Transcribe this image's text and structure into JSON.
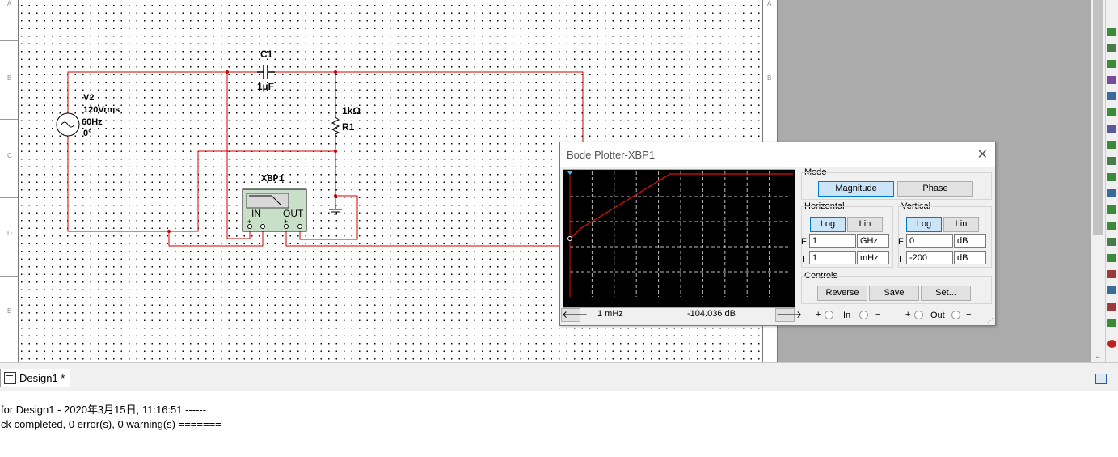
{
  "circuit": {
    "capacitor": {
      "name": "C1",
      "value": "1µF"
    },
    "resistor": {
      "name": "R1",
      "value": "1kΩ"
    },
    "source": {
      "name": "V2",
      "voltage": "120Vrms",
      "freq": "60Hz",
      "phase": "0°"
    },
    "instrument": {
      "name": "XBP1",
      "in_label": "IN",
      "out_label": "OUT"
    },
    "wire_color": "#d00000",
    "row_labels": [
      "A",
      "B",
      "C",
      "D",
      "E"
    ]
  },
  "bode": {
    "title": "Bode Plotter-XBP1",
    "mode_label": "Mode",
    "magnitude_label": "Magnitude",
    "phase_label": "Phase",
    "horizontal_label": "Horizontal",
    "vertical_label": "Vertical",
    "log_label": "Log",
    "lin_label": "Lin",
    "h_f_label": "F",
    "h_i_label": "I",
    "v_f_label": "F",
    "v_i_label": "I",
    "h_final": "1",
    "h_final_unit": "GHz",
    "h_initial": "1",
    "h_initial_unit": "mHz",
    "v_final": "0",
    "v_final_unit": "dB",
    "v_initial": "-200",
    "v_initial_unit": "dB",
    "controls_label": "Controls",
    "reverse_label": "Reverse",
    "save_label": "Save",
    "set_label": "Set...",
    "readout_freq": "1 mHz",
    "readout_value": "-104.036 dB",
    "in_label": "In",
    "out_label": "Out",
    "plus": "+",
    "minus": "−",
    "left_arrow": "🡐",
    "right_arrow": "🡒",
    "close": "✕",
    "trace_color": "#e01010"
  },
  "tabs": [
    {
      "label": "Design1 *"
    }
  ],
  "output": {
    "line1": "for Design1 - 2020年3月15日, 11:16:51 ------",
    "line2": "ck completed, 0 error(s), 0 warning(s) ======="
  },
  "scroll": {
    "down_arrow": "⌄"
  }
}
